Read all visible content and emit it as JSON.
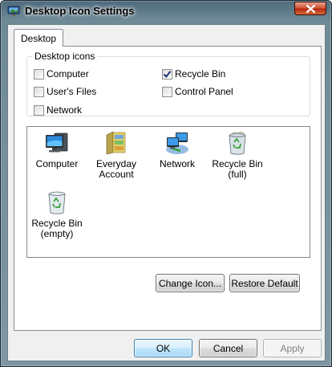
{
  "window": {
    "title": "Desktop Icon Settings",
    "title_icon": "display-settings-icon"
  },
  "tabs": [
    {
      "label": "Desktop",
      "selected": true
    }
  ],
  "desktop_icons_group": {
    "legend": "Desktop icons",
    "checkboxes": [
      {
        "label": "Computer",
        "checked": false
      },
      {
        "label": "User's Files",
        "checked": false
      },
      {
        "label": "Network",
        "checked": false
      },
      {
        "label": "Recycle Bin",
        "checked": true
      },
      {
        "label": "Control Panel",
        "checked": false
      }
    ]
  },
  "icon_list": {
    "items": [
      {
        "label_line1": "Computer",
        "label_line2": "",
        "icon": "computer-icon"
      },
      {
        "label_line1": "Everyday",
        "label_line2": "Account",
        "icon": "user-folder-icon"
      },
      {
        "label_line1": "Network",
        "label_line2": "",
        "icon": "network-icon"
      },
      {
        "label_line1": "Recycle Bin",
        "label_line2": "(full)",
        "icon": "recycle-bin-full-icon"
      },
      {
        "label_line1": "Recycle Bin",
        "label_line2": "(empty)",
        "icon": "recycle-bin-empty-icon"
      }
    ]
  },
  "buttons": {
    "change_icon": "Change Icon...",
    "restore_default": "Restore Default",
    "ok": "OK",
    "cancel": "Cancel",
    "apply": "Apply"
  },
  "colors": {
    "titlebar": "#6f8a97",
    "close_button": "#c9432a",
    "default_button_border": "#3c7fb1",
    "checkmark": "#1f2d73"
  }
}
